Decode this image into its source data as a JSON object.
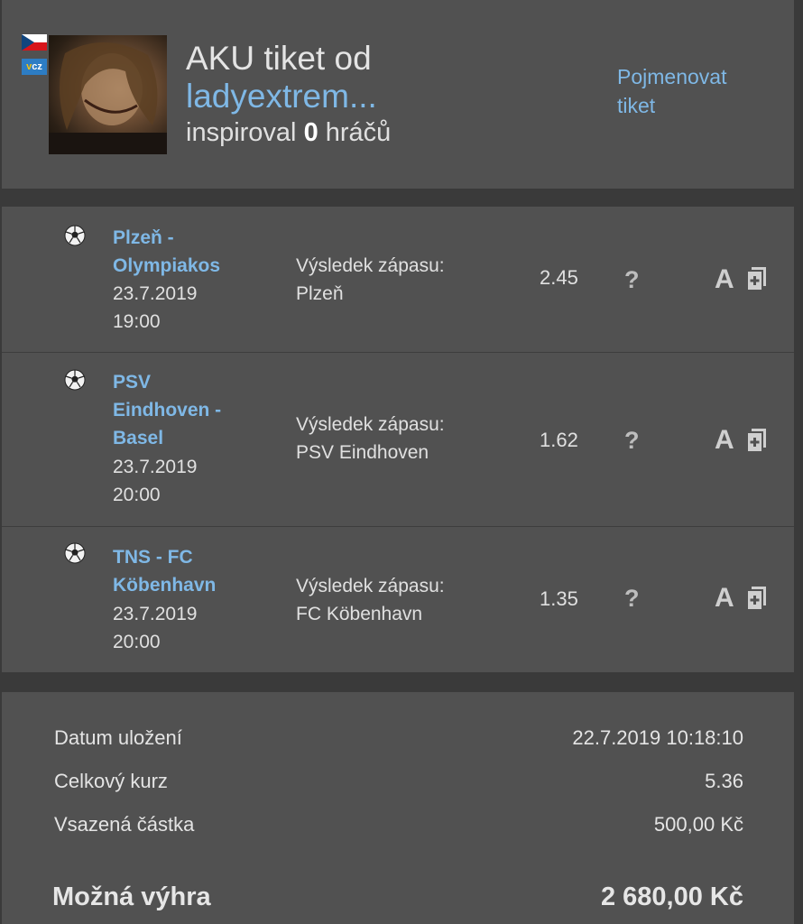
{
  "header": {
    "title_prefix": "AKU tiket od",
    "username": "ladyextrem...",
    "inspired_prefix": "inspiroval",
    "inspired_count": "0",
    "inspired_suffix": "hráčů",
    "rename_line1": "Pojmenovat",
    "rename_line2": "tiket",
    "badge_label": "cz"
  },
  "matches": [
    {
      "icon": "soccer-ball-icon",
      "team_line1": "Plzeň -",
      "team_line2": "Olympiakos",
      "date": "23.7.2019",
      "time": "19:00",
      "bet_label": "Výsledek zápasu:",
      "bet_pick": "Plzeň",
      "odd": "2.45",
      "status": "?",
      "type": "A"
    },
    {
      "icon": "soccer-ball-icon",
      "team_line1": "PSV",
      "team_line2": "Eindhoven -",
      "team_line3": "Basel",
      "date": "23.7.2019",
      "time": "20:00",
      "bet_label": "Výsledek zápasu:",
      "bet_pick": "PSV Eindhoven",
      "odd": "1.62",
      "status": "?",
      "type": "A"
    },
    {
      "icon": "soccer-ball-icon",
      "team_line1": "TNS - FC",
      "team_line2": "Köbenhavn",
      "date": "23.7.2019",
      "time": "20:00",
      "bet_label": "Výsledek zápasu:",
      "bet_pick": "FC Köbenhavn",
      "odd": "1.35",
      "status": "?",
      "type": "A"
    }
  ],
  "summary": {
    "saved_label": "Datum uložení",
    "saved_value": "22.7.2019 10:18:10",
    "total_odds_label": "Celkový kurz",
    "total_odds_value": "5.36",
    "stake_label": "Vsazená částka",
    "stake_value": "500,00 Kč",
    "win_label": "Možná výhra",
    "win_value": "2 680,00 Kč"
  },
  "colors": {
    "accent_link": "#7fb8e6",
    "card_bg": "#515151",
    "page_bg": "#3a3a3a"
  }
}
